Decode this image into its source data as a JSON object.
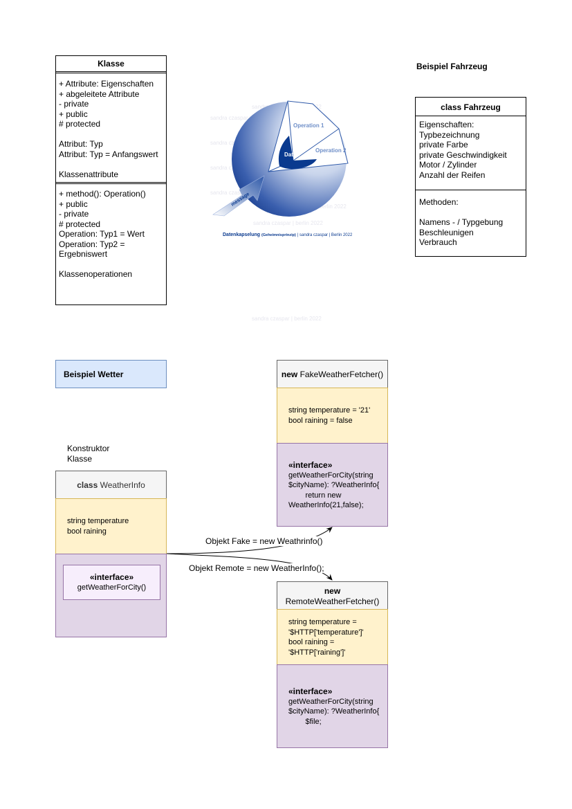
{
  "klasse": {
    "title": "Klasse",
    "attributes": [
      "+ Attribute: Eigenschaften",
      "+ abgeleitete Attribute",
      "- private",
      "+ public",
      "# protected",
      "",
      "Attribut: Typ",
      "Attribut: Typ = Anfangswert",
      "",
      "Klassenattribute"
    ],
    "operations": [
      "+ method(): Operation()",
      "+ public",
      "- private",
      "# protected",
      "Operation: Typ1 = Wert",
      "Operation: Typ2 =",
      "Ergebniswert",
      "",
      "Klassenoperationen"
    ]
  },
  "encapsulation": {
    "label_data": "Daten",
    "label_op1": "Operation 1",
    "label_op2": "Operation 2",
    "label_message": "message",
    "caption_main": "Datenkapselung",
    "caption_sub": "(Geheimnisprinzip)",
    "caption_rest": "| sandra czaspar | Berlin 2022",
    "watermark": "sandra czaspar | berlin 2022"
  },
  "fahrzeug": {
    "heading": "Beispiel Fahrzeug",
    "title": "class Fahrzeug",
    "properties": [
      "Eigenschaften:",
      "Typbezeichnung",
      "private Farbe",
      "private Geschwindigkeit",
      "Motor / Zylinder",
      "Anzahl der Reifen"
    ],
    "methods": [
      "Methoden:",
      "",
      "Namens - / Typgebung",
      "Beschleunigen",
      "Verbrauch"
    ]
  },
  "wetter": {
    "heading": "Beispiel Wetter",
    "konstruktor": [
      "Konstruktor",
      "Klasse"
    ],
    "weatherinfo": {
      "title_bold": "class",
      "title_rest": "WeatherInfo",
      "fields": [
        "string temperature",
        "bool raining"
      ],
      "interface_title": "«interface»",
      "interface_method": "getWeatherForCity()"
    },
    "fake": {
      "title_bold": "new",
      "title_rest": "FakeWeatherFetcher()",
      "fields": [
        "string temperature = '21'",
        "bool raining = false"
      ],
      "interface_title": "«interface»",
      "code": [
        "getWeatherForCity(string",
        "$cityName): ?WeatherInfo{",
        "        return new",
        "WeatherInfo(21,false);"
      ]
    },
    "remote": {
      "title_bold": "new",
      "title_rest": "RemoteWeatherFetcher()",
      "fields": [
        "string temperature =",
        "'$HTTP['temperature']'",
        "bool raining =",
        "'$HTTP['raining']'"
      ],
      "interface_title": "«interface»",
      "code": [
        "getWeatherForCity(string",
        "$cityName): ?WeatherInfo{",
        "        $file;"
      ]
    },
    "edge_fake": "Objekt Fake = new Weathrinfo()",
    "edge_remote": "Objekt Remote = new WeatherInfo();"
  },
  "colors": {
    "yellow": "#fff2cc",
    "purple": "#e1d5e7",
    "blue": "#dae8fc",
    "gray": "#f5f5f5",
    "dark_blue": "#0a3a8f"
  }
}
